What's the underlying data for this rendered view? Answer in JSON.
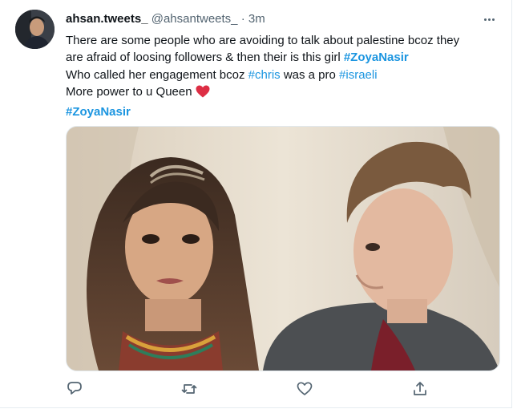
{
  "tweet": {
    "author_name": "ahsan.tweets_",
    "author_handle": "@ahsantweets_",
    "separator": "·",
    "timestamp": "3m",
    "lines": {
      "l1": "There are some people who are avoiding to talk about palestine bcoz they",
      "l2_text": "are afraid of loosing followers & then their is this girl ",
      "l2_tag": "#ZoyaNasir",
      "l3_text": "Who called her engagement bcoz ",
      "l3_tag1": "#chris",
      "l3_mid": " was a pro ",
      "l3_tag2": "#israeli",
      "l4_text": "More power to u Queen ",
      "l5_tag": "#ZoyaNasir"
    },
    "colors": {
      "hashtag": "#1b95e0",
      "text": "#0f1419",
      "muted": "#536471",
      "heart": "#dd2e44"
    },
    "icons": [
      "more-icon",
      "reply-icon",
      "retweet-icon",
      "like-icon",
      "share-icon",
      "heart-emoji"
    ]
  }
}
